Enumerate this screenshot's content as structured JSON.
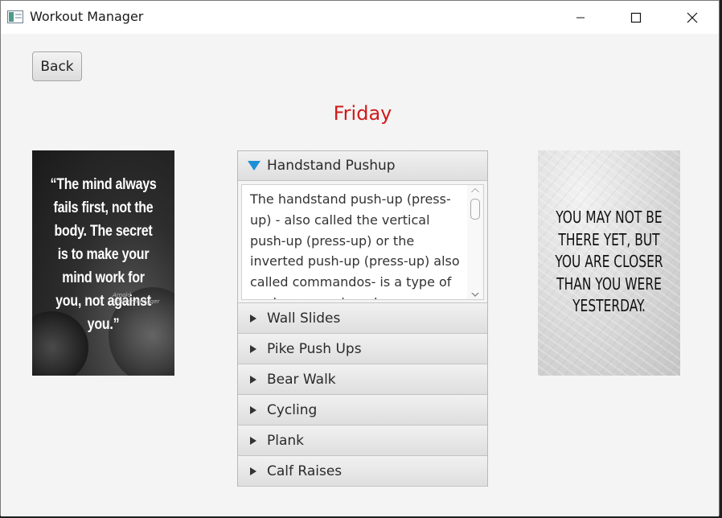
{
  "window": {
    "title": "Workout Manager"
  },
  "toolbar": {
    "back_label": "Back"
  },
  "page": {
    "title": "Friday",
    "title_color": "#d11a1a"
  },
  "posters": {
    "left": {
      "quote": "“The mind always fails first, not the body. The secret is to make your mind work for you, not against you.”",
      "signature": "Arnold Schwarzenegger"
    },
    "right": {
      "quote": "YOU MAY NOT BE THERE YET, BUT YOU ARE CLOSER THAN YOU WERE YESTERDAY."
    }
  },
  "exercises": {
    "expanded": {
      "title": "Handstand Pushup",
      "description": "The handstand push-up (press-up) - also called the vertical push-up (press-up) or the inverted push-up (press-up) also called commandos- is a type of push-up exercise where"
    },
    "collapsed": [
      {
        "title": "Wall Slides"
      },
      {
        "title": "Pike Push Ups"
      },
      {
        "title": "Bear Walk"
      },
      {
        "title": "Cycling"
      },
      {
        "title": "Plank"
      },
      {
        "title": "Calf Raises"
      }
    ]
  },
  "icons": {
    "expanded_arrow": "chevron-down-icon",
    "collapsed_arrow": "chevron-right-icon",
    "accent": "#1e8fd6"
  }
}
